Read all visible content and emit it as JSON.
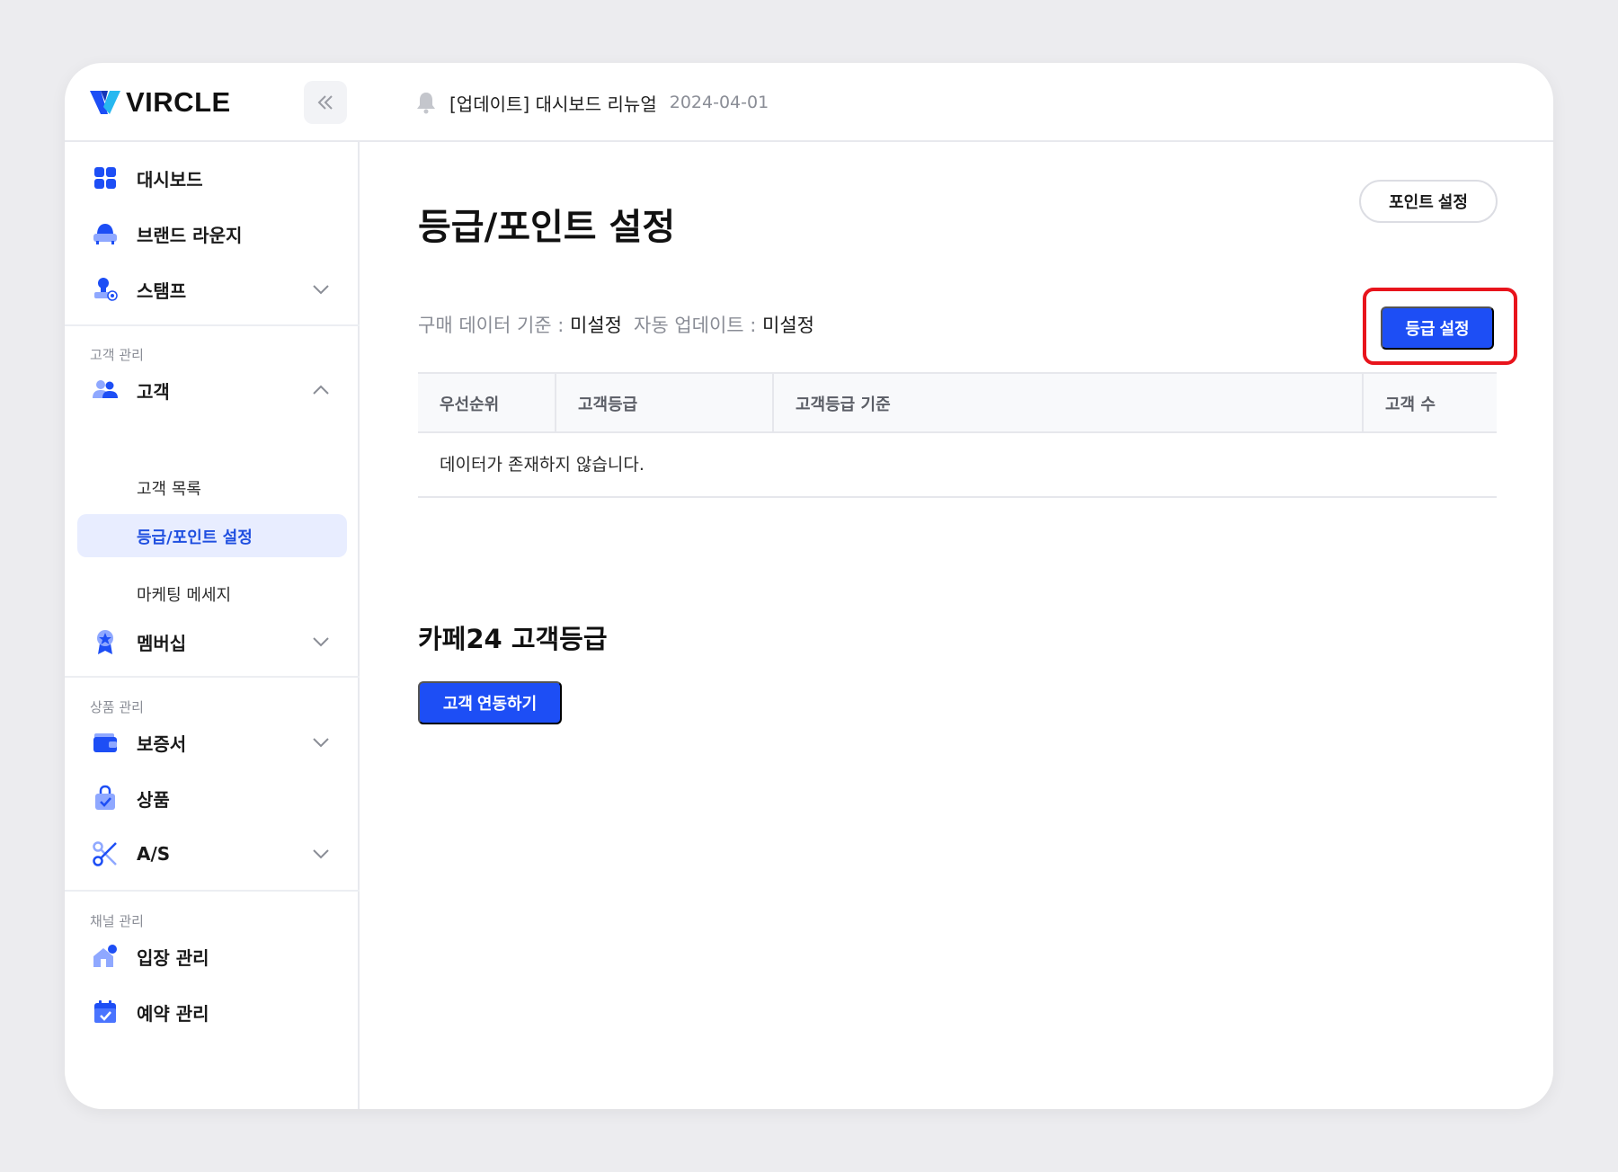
{
  "header": {
    "brand": "VIRCLE",
    "notice_text": "[업데이트] 대시보드 리뉴얼",
    "notice_date": "2024-04-01"
  },
  "sidebar": {
    "items": [
      {
        "label": "대시보드",
        "icon": "dashboard-icon"
      },
      {
        "label": "브랜드 라운지",
        "icon": "armchair-icon"
      },
      {
        "label": "스탬프",
        "icon": "stamp-icon"
      },
      {
        "label": "고객",
        "icon": "users-icon"
      },
      {
        "label": "멤버십",
        "icon": "badge-icon"
      },
      {
        "label": "보증서",
        "icon": "wallet-icon"
      },
      {
        "label": "상품",
        "icon": "shopping-bag-icon"
      },
      {
        "label": "A/S",
        "icon": "scissors-icon"
      },
      {
        "label": "입장 관리",
        "icon": "house-icon"
      },
      {
        "label": "예약 관리",
        "icon": "calendar-icon"
      }
    ],
    "sections": {
      "customer": "고객 관리",
      "product": "상품 관리",
      "channel": "채널 관리"
    },
    "sub_items": {
      "customer_list": "고객 목록",
      "grade_point": "등급/포인트 설정",
      "marketing": "마케팅 메세지"
    }
  },
  "content": {
    "title": "등급/포인트 설정",
    "point_button": "포인트 설정",
    "grade_button": "등급 설정",
    "purchase_key": "구매 데이터 기준 : ",
    "purchase_value": "미설정",
    "auto_key": "자동 업데이트 : ",
    "auto_value": "미설정",
    "table": {
      "columns": [
        "우선순위",
        "고객등급",
        "고객등급 기준",
        "고객 수"
      ],
      "empty": "데이터가 존재하지 않습니다."
    },
    "cafe_title": "카페24 고객등급",
    "link_button": "고객 연동하기"
  },
  "colors": {
    "accent": "#1d4ef5",
    "highlight": "#e8141c",
    "active_bg": "#e8edff"
  }
}
